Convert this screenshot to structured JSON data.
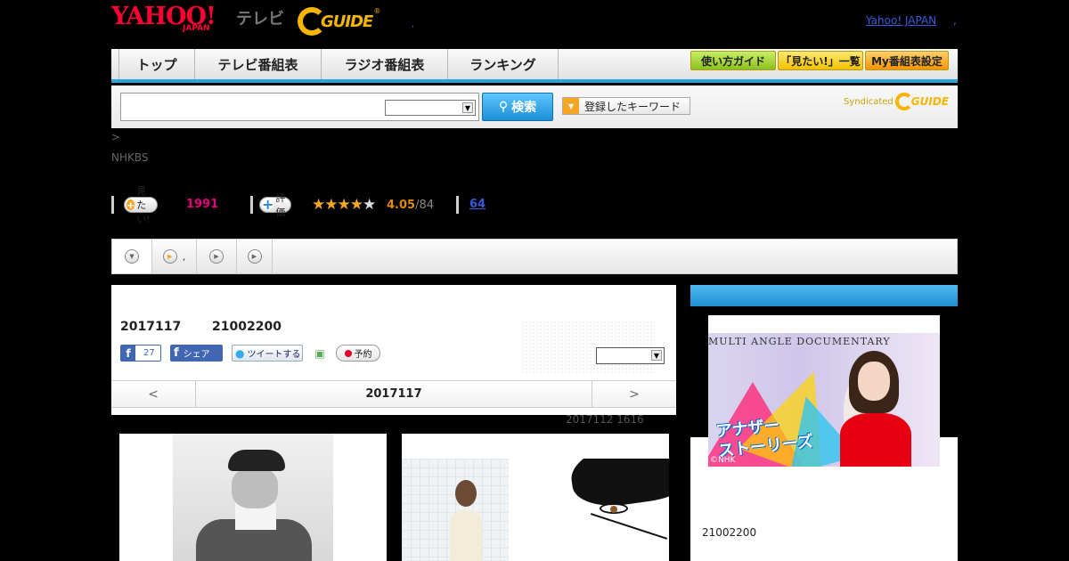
{
  "header": {
    "logo_yahoo": "YAHOO!",
    "logo_yahoo_sub": "JAPAN",
    "logo_tv": "テレビ",
    "logo_gguide": "GUIDE",
    "logo_gguide_reg": "®",
    "dot": ",",
    "yahoo_japan_link": "Yahoo! JAPAN",
    "yahoo_japan_dot": ","
  },
  "nav": {
    "tabs": [
      "トップ",
      "テレビ番組表",
      "ラジオ番組表",
      "ランキング"
    ],
    "buttons": [
      "使い方ガイド",
      "「見たい!」一覧",
      "My番組表設定"
    ]
  },
  "search": {
    "value": "",
    "select_value": "",
    "button_label": "検索",
    "keyword_button": "登録したキーワード",
    "syndicated": "Syndicated",
    "syndicated_logo": "GUIDE"
  },
  "breadcrumb": ">",
  "channel": "NHKBS",
  "stats": {
    "want_label": "見たい!",
    "want_count": "1991",
    "rate_label": "評価",
    "rating": 4.05,
    "rating_text": "4.05",
    "rating_count": "/84",
    "reviews": "64"
  },
  "subtabs": [
    ",",
    "",
    ""
  ],
  "program": {
    "date": "2017117",
    "time": "21002200",
    "fb_like_count": "27",
    "fb_share": "シェア",
    "tweet": "ツイートする",
    "reserve": "予約",
    "select_value": ""
  },
  "datenav": {
    "prev": "<",
    "current": "2017117",
    "next": ">"
  },
  "updated": "2017112  1616",
  "promo": {
    "banner_title": "MULTI ANGLE DOCUMENTARY",
    "title_line1": "アナザー",
    "title_line2": "ストーリーズ",
    "credit": "©NHK",
    "time": "21002200"
  }
}
